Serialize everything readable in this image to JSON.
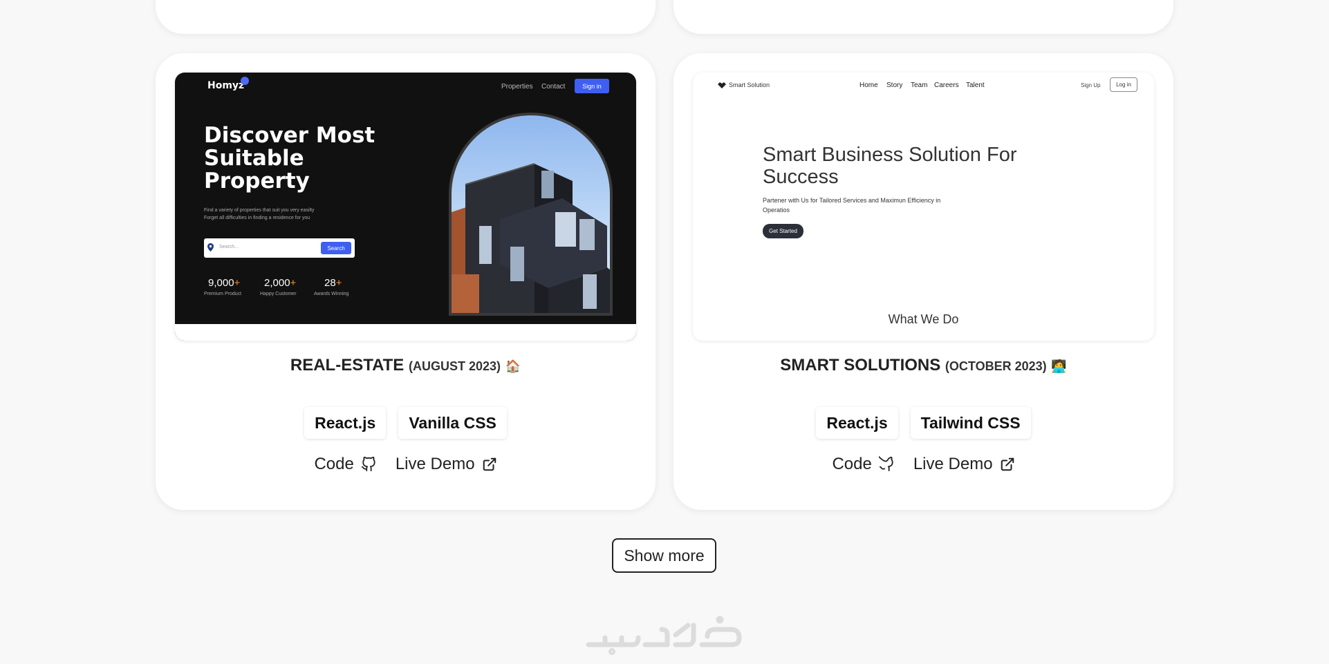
{
  "projects": [
    {
      "title": "REAL-ESTATE",
      "date": "(AUGUST 2023)",
      "emoji": "🏠",
      "tags": [
        "React.js",
        "Vanilla CSS"
      ],
      "links": {
        "code": "Code",
        "demo": "Live Demo"
      },
      "preview": {
        "logo": "Homyz",
        "nav": [
          "Properties",
          "Contact"
        ],
        "signin": "Sign in",
        "headline": "Discover Most Suitable Property",
        "sub1": "Find a variety of properties that suit you very easilty",
        "sub2": "Forget all difficulties in finding a residence for you",
        "search_placeholder": "Search...",
        "search_button": "Search",
        "stats": [
          {
            "value": "9,000",
            "plus": "+",
            "label": "Premium Product"
          },
          {
            "value": "2,000",
            "plus": "+",
            "label": "Happy Customer"
          },
          {
            "value": "28",
            "plus": "+",
            "label": "Awards Winning"
          }
        ]
      }
    },
    {
      "title": "SMART SOLUTIONS",
      "date": "(OCTOBER 2023)",
      "emoji": "🧑‍💻",
      "tags": [
        "React.js",
        "Tailwind CSS"
      ],
      "links": {
        "code": "Code",
        "demo": "Live Demo"
      },
      "preview": {
        "logo": "Smart Solution",
        "nav": [
          "Home",
          "Story",
          "Team",
          "Careers",
          "Talent"
        ],
        "signup": "Sign Up",
        "login": "Log in",
        "headline": "Smart Business Solution For Success",
        "sub": "Partener with Us for Tailored Services and Maximun Efficiency in Operatios",
        "button": "Get Started",
        "section": "What We Do"
      }
    }
  ],
  "show_more": "Show more",
  "colors": {
    "accent_blue": "#3f5ff2",
    "orange_plus": "#f2922f",
    "background": "#f8f8f8"
  }
}
